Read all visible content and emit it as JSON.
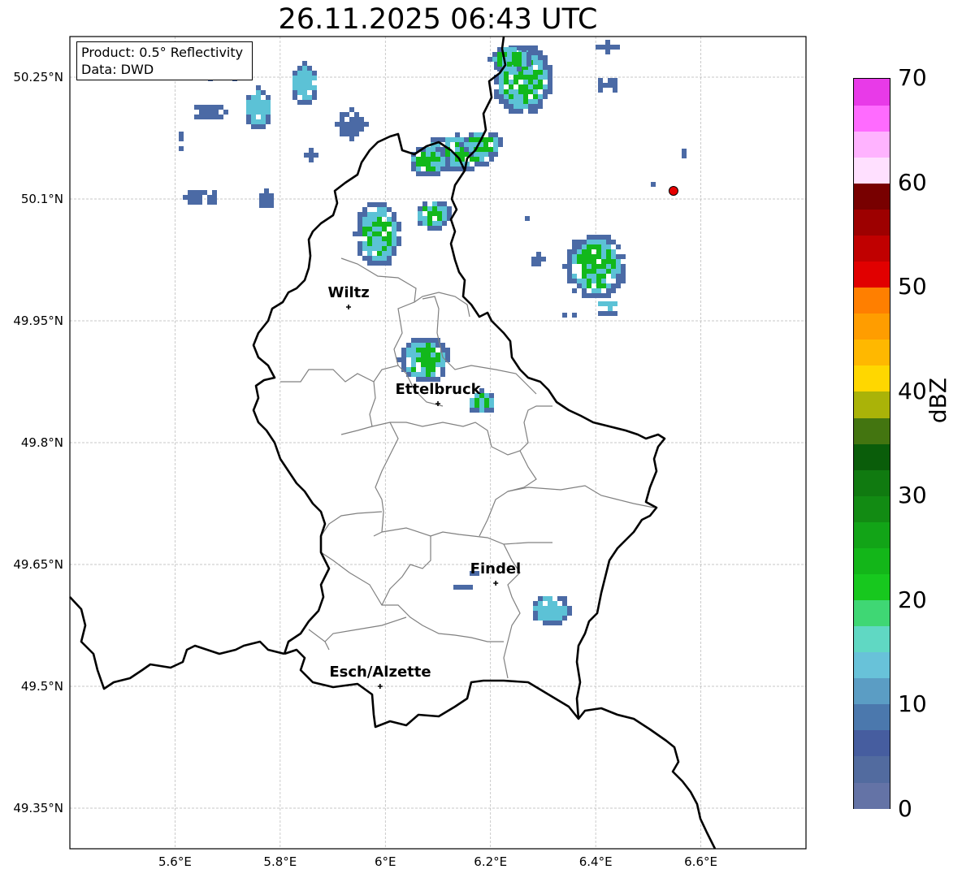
{
  "title": "26.11.2025 06:43 UTC",
  "info": {
    "line1": "Product: 0.5° Reflectivity",
    "line2": "Data: DWD"
  },
  "lat_ticks": [
    "50.25°N",
    "50.1°N",
    "49.95°N",
    "49.8°N",
    "49.65°N",
    "49.5°N",
    "49.35°N"
  ],
  "lon_ticks": [
    "5.6°E",
    "5.8°E",
    "6°E",
    "6.2°E",
    "6.4°E",
    "6.6°E"
  ],
  "cities": [
    {
      "name": "Wiltz",
      "lon": 5.93,
      "lat": 49.967
    },
    {
      "name": "Ettelbruck",
      "lon": 6.1,
      "lat": 49.848
    },
    {
      "name": "Findel",
      "lon": 6.21,
      "lat": 49.627
    },
    {
      "name": "Esch/Alzette",
      "lon": 5.99,
      "lat": 49.5
    }
  ],
  "marker": {
    "lon": 6.548,
    "lat": 50.11,
    "color": "#e60000"
  },
  "map_extent": {
    "lon": [
      5.4,
      6.8
    ],
    "lat": [
      49.3,
      50.3
    ]
  },
  "colorbar": {
    "label": "dBZ",
    "ticks": [
      "0",
      "10",
      "20",
      "30",
      "40",
      "50",
      "60",
      "70"
    ],
    "range": [
      0,
      70
    ],
    "colors": [
      "#6473a6",
      "#526b9f",
      "#465d9f",
      "#4b78ad",
      "#5b9dc4",
      "#68c2d9",
      "#60d8c3",
      "#3fd774",
      "#17c81e",
      "#13b619",
      "#12a417",
      "#128b13",
      "#107a10",
      "#0a5d0a",
      "#437510",
      "#aab308",
      "#ffd700",
      "#ffb800",
      "#ff9d00",
      "#ff7f00",
      "#e10000",
      "#c00000",
      "#9d0000",
      "#780000",
      "#ffe0ff",
      "#ffb3ff",
      "#ff6bff",
      "#e83ae8"
    ]
  },
  "precip_colors": {
    "low": "#4b6aa5",
    "mid": "#5cc2d6",
    "high": "#12b81b"
  }
}
